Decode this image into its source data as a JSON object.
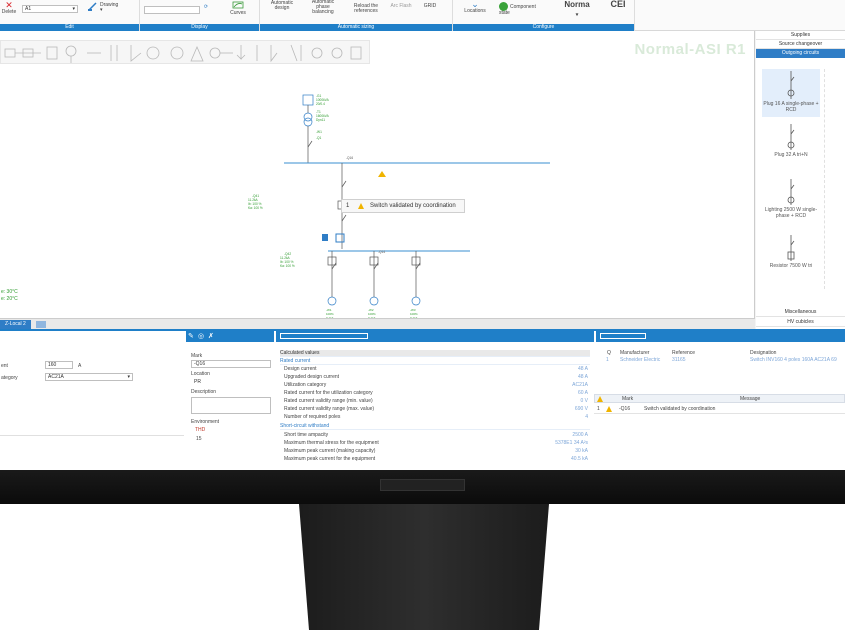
{
  "ribbon": {
    "delete": "Delete",
    "a1_value": "A1",
    "drawing": "Drawing",
    "curves": "Curves",
    "automatic_design": "Automatic\ndesign",
    "automatic_phase": "Automatic\nphase\nbalancing",
    "reload_refs": "Reload the\nreferences",
    "arc_flash": "Arc Flash",
    "grid": "GRID",
    "locations": "Locations",
    "component_state": "Component\nstate",
    "norma": "Norma",
    "cei": "CEI",
    "groups": {
      "edit": "Edit",
      "display": "Display",
      "auto_sizing": "Automatic sizing",
      "configure": "Configure"
    }
  },
  "canvas": {
    "watermark": "Normal-ASI R1",
    "callout_num": "1",
    "callout_text": "Switch validated by coordination",
    "left_notes": [
      "e: 30°C",
      "e: 20°C"
    ],
    "mark_q16": "-Q16",
    "mark_q14": "-Q14"
  },
  "tabstrip": {
    "tab": "Z-Local 2"
  },
  "right_panel": {
    "supplies": "Supplies",
    "source_changeover": "Source changeover",
    "outgoing": "Outgoing circuits",
    "items": [
      "Plug 16 A single-phase + RCD",
      "Plug 32 A tri+N",
      "Lighting 2500 W single-phase + RCD",
      "Resistor 7500 W tri"
    ],
    "miscellaneous": "Miscellaneous",
    "hv_cubicles": "HV cubicles"
  },
  "left_props": {
    "rows": [
      {
        "label": "ent",
        "value": "160",
        "unit": "A"
      },
      {
        "label": "ategory",
        "value": "AC21A"
      }
    ]
  },
  "mark_panel": {
    "mark_label": "Mark",
    "mark_value": "-Q16",
    "location_label": "Location",
    "location_value": "PR",
    "description_label": "Description",
    "environment_label": "Environment",
    "thd_label": "THD",
    "thd_value": "15"
  },
  "calc": {
    "title": "Calculated values",
    "rated_current": "Rated current",
    "rows": [
      {
        "k": "Design current",
        "v": "48 A"
      },
      {
        "k": "Upgraded design current",
        "v": "48 A"
      },
      {
        "k": "Utilization category",
        "v": "AC21A"
      },
      {
        "k": "Rated current for the utilization category",
        "v": "60 A"
      },
      {
        "k": "Rated current validity range (min. value)",
        "v": "0 V"
      },
      {
        "k": "Rated current validity range (max. value)",
        "v": "690 V"
      },
      {
        "k": "Number of required poles",
        "v": "4"
      }
    ],
    "short_circuit": "Short-circuit withstand",
    "rows2": [
      {
        "k": "Short time ampacity",
        "v": "2500 A"
      },
      {
        "k": "Maximum thermal stress for the equipment",
        "v": "5378E1 34 A²s"
      },
      {
        "k": "Maximum peak current (making capacity)",
        "v": "30 kA"
      },
      {
        "k": "Maximum peak current for the equipment",
        "v": "40.5 kA"
      }
    ]
  },
  "parts": {
    "headers": {
      "q": "Q",
      "manufacturer": "Manufacturer",
      "reference": "Reference",
      "designation": "Designation"
    },
    "row": {
      "q": "1",
      "manufacturer": "Schneider Electric",
      "reference": "31165",
      "designation": "Switch INV160 4 poles 160A AC21A 69"
    }
  },
  "messages": {
    "headers": {
      "mark": "Mark",
      "message": "Message"
    },
    "row": {
      "num": "1",
      "mark": "-Q16",
      "message": "Switch validated by coordination"
    }
  },
  "colors": {
    "accent": "#1f7fc8",
    "busbar": "#3a8fd0",
    "warning": "#f0b400",
    "green": "#2e9b2e"
  }
}
